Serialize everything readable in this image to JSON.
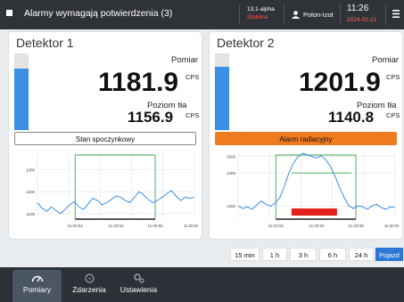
{
  "topbar": {
    "title": "Alarmy wymagają potwierdzenia (3)",
    "version": "13.1-alpha",
    "version_status": "Stabilna",
    "user": "Polon-Izot",
    "time": "11:26",
    "date": "2024-02-21"
  },
  "detectors": [
    {
      "name": "Detektor 1",
      "measurement_label": "Pomiar",
      "measurement_value": "1181.9",
      "unit": "CPS",
      "background_label": "Poziom tła",
      "background_value": "1156.9",
      "state": "Stan spoczynkowy",
      "level_percent": 80,
      "chart_data": {
        "type": "line",
        "y_ticks": [
          "1300",
          "1200",
          "1100"
        ],
        "x_ticks": [
          "11:20:02",
          "11:20:04",
          "11:20:06",
          "11:20:08"
        ],
        "ylim": [
          1075,
          1375
        ],
        "values": [
          1150,
          1125,
          1110,
          1130,
          1115,
          1100,
          1120,
          1140,
          1155,
          1130,
          1120,
          1145,
          1170,
          1160,
          1140,
          1150,
          1165,
          1180,
          1175,
          1160,
          1150,
          1175,
          1200,
          1185,
          1165,
          1150,
          1160,
          1175,
          1190,
          1205,
          1180,
          1160,
          1175,
          1170,
          1175
        ]
      }
    },
    {
      "name": "Detektor 2",
      "measurement_label": "Pomiar",
      "measurement_value": "1201.9",
      "unit": "CPS",
      "background_label": "Poziom tła",
      "background_value": "1140.8",
      "state": "Alarm radiacyjny",
      "level_percent": 83,
      "chart_data": {
        "type": "line",
        "y_ticks": [
          "1500",
          "1400",
          "1200"
        ],
        "x_ticks": [
          "11:20:02",
          "11:20:04",
          "11:20:06",
          "11:20:08"
        ],
        "ylim": [
          1120,
          1520
        ],
        "values": [
          1200,
          1185,
          1195,
          1180,
          1205,
          1230,
          1210,
          1200,
          1215,
          1250,
          1320,
          1400,
          1460,
          1500,
          1520,
          1510,
          1500,
          1490,
          1505,
          1480,
          1440,
          1380,
          1310,
          1250,
          1200,
          1185,
          1200,
          1195,
          1180,
          1200,
          1210,
          1190,
          1180,
          1195,
          1190
        ]
      }
    }
  ],
  "time_range_buttons": [
    "15 min",
    "1 h",
    "3 h",
    "6 h",
    "24 h",
    "Pojazd"
  ],
  "time_range_active": "Pojazd",
  "tabs": [
    {
      "label": "Pomiary",
      "icon": "gauge-icon",
      "active": true
    },
    {
      "label": "Zdarzenia",
      "icon": "clock-icon",
      "active": false
    },
    {
      "label": "Ustawienia",
      "icon": "gears-icon",
      "active": false
    }
  ],
  "colors": {
    "accent": "#2b78d6",
    "alarm": "#f07a1e",
    "chart_line": "#3a8ee6",
    "window_marker": "#3aa84a",
    "alarm_marker": "#e5211c"
  }
}
